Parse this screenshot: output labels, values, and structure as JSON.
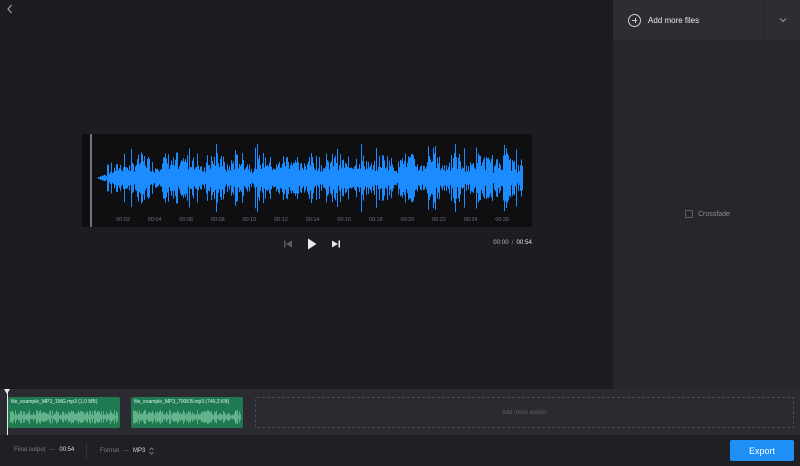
{
  "editor": {
    "back_icon": "chevron-left-icon",
    "waveform": {
      "color": "#1a8cff",
      "background": "#0f0f12",
      "ticks": [
        "00:02",
        "00:04",
        "00:06",
        "00:08",
        "00:10",
        "00:12",
        "00:14",
        "00:16",
        "00:18",
        "00:20",
        "00:22",
        "00:24",
        "00:26"
      ]
    },
    "transport": {
      "prev_icon": "skip-back-icon",
      "play_icon": "play-icon",
      "next_icon": "skip-forward-icon",
      "current_time": "00:00",
      "separator": "/",
      "duration": "00:54"
    }
  },
  "side_panel": {
    "add_files_label": "Add more files",
    "add_files_icon": "plus-circle-icon",
    "dropdown_icon": "chevron-down-icon",
    "crossfade_label": "Crossfade",
    "crossfade_checked": false
  },
  "timeline": {
    "clips": [
      {
        "name": "file_example_MP3_1MG.mp3 (1,0 MB)"
      },
      {
        "name": "file_example_MP3_700KB.mp3 (746,3 KB)"
      }
    ],
    "add_more_label": "Add more audios",
    "clip_color": "#1f7a52"
  },
  "footer": {
    "final_output_label": "Final output",
    "final_output_value": "00:54",
    "format_label": "Format",
    "format_value": "MP3",
    "dash": "—",
    "export_label": "Export",
    "export_color": "#1e8ff5"
  }
}
